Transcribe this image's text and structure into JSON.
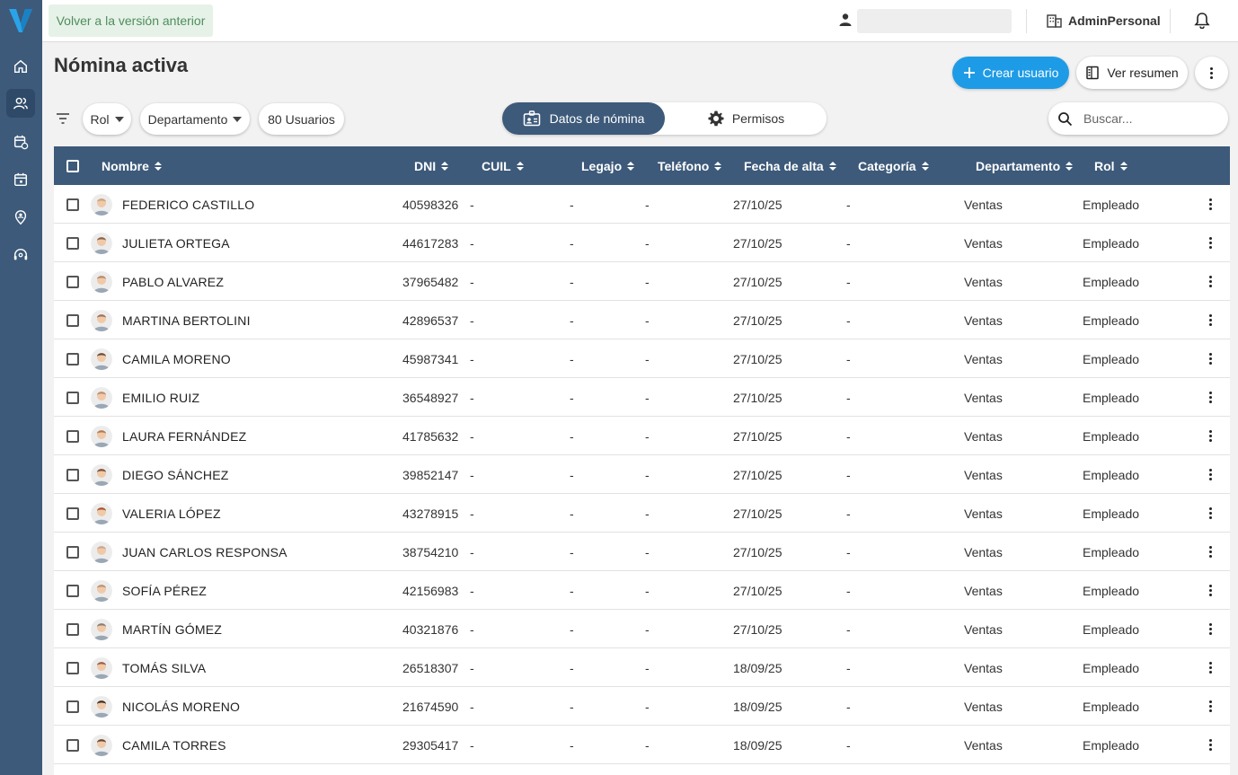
{
  "topbar": {
    "back_label": "Volver a la versión anterior",
    "org_name": "AdminPersonal"
  },
  "page": {
    "title": "Nómina activa",
    "create_label": "Crear usuario",
    "summary_label": "Ver resumen"
  },
  "filters": {
    "rol_label": "Rol",
    "departamento_label": "Departamento",
    "count_label": "80 Usuarios",
    "tab_nomina": "Datos de nómina",
    "tab_permisos": "Permisos",
    "search_placeholder": "Buscar..."
  },
  "colors": {
    "sidebar": "#3d5a7a",
    "accent": "#1e9be6",
    "back_bg": "#e6f2e8",
    "back_text": "#4f8d5c"
  },
  "table": {
    "columns": {
      "nombre": "Nombre",
      "dni": "DNI",
      "cuil": "CUIL",
      "legajo": "Legajo",
      "telefono": "Teléfono",
      "fecha": "Fecha de alta",
      "categoria": "Categoría",
      "departamento": "Departamento",
      "rol": "Rol"
    },
    "rows": [
      {
        "nombre": "FEDERICO CASTILLO",
        "dni": "40598326",
        "cuil": "-",
        "legajo": "-",
        "telefono": "-",
        "fecha": "27/10/25",
        "categoria": "-",
        "departamento": "Ventas",
        "rol": "Empleado",
        "avatar_color": "#c9a27e"
      },
      {
        "nombre": "JULIETA ORTEGA",
        "dni": "44617283",
        "cuil": "-",
        "legajo": "-",
        "telefono": "-",
        "fecha": "27/10/25",
        "categoria": "-",
        "departamento": "Ventas",
        "rol": "Empleado",
        "avatar_color": "#8a6347"
      },
      {
        "nombre": "PABLO ALVAREZ",
        "dni": "37965482",
        "cuil": "-",
        "legajo": "-",
        "telefono": "-",
        "fecha": "27/10/25",
        "categoria": "-",
        "departamento": "Ventas",
        "rol": "Empleado",
        "avatar_color": "#b58a6c"
      },
      {
        "nombre": "MARTINA BERTOLINI",
        "dni": "42896537",
        "cuil": "-",
        "legajo": "-",
        "telefono": "-",
        "fecha": "27/10/25",
        "categoria": "-",
        "departamento": "Ventas",
        "rol": "Empleado",
        "avatar_color": "#a0705a"
      },
      {
        "nombre": "CAMILA MORENO",
        "dni": "45987341",
        "cuil": "-",
        "legajo": "-",
        "telefono": "-",
        "fecha": "27/10/25",
        "categoria": "-",
        "departamento": "Ventas",
        "rol": "Empleado",
        "avatar_color": "#6b4a36"
      },
      {
        "nombre": "EMILIO RUIZ",
        "dni": "36548927",
        "cuil": "-",
        "legajo": "-",
        "telefono": "-",
        "fecha": "27/10/25",
        "categoria": "-",
        "departamento": "Ventas",
        "rol": "Empleado",
        "avatar_color": "#c08d6b"
      },
      {
        "nombre": "LAURA FERNÁNDEZ",
        "dni": "41785632",
        "cuil": "-",
        "legajo": "-",
        "telefono": "-",
        "fecha": "27/10/25",
        "categoria": "-",
        "departamento": "Ventas",
        "rol": "Empleado",
        "avatar_color": "#b07a55"
      },
      {
        "nombre": "DIEGO SÁNCHEZ",
        "dni": "39852147",
        "cuil": "-",
        "legajo": "-",
        "telefono": "-",
        "fecha": "27/10/25",
        "categoria": "-",
        "departamento": "Ventas",
        "rol": "Empleado",
        "avatar_color": "#7d4e38"
      },
      {
        "nombre": "VALERIA LÓPEZ",
        "dni": "43278915",
        "cuil": "-",
        "legajo": "-",
        "telefono": "-",
        "fecha": "27/10/25",
        "categoria": "-",
        "departamento": "Ventas",
        "rol": "Empleado",
        "avatar_color": "#a8542f"
      },
      {
        "nombre": "JUAN CARLOS RESPONSA",
        "dni": "38754210",
        "cuil": "-",
        "legajo": "-",
        "telefono": "-",
        "fecha": "27/10/25",
        "categoria": "-",
        "departamento": "Ventas",
        "rol": "Empleado",
        "avatar_color": "#c9a88e"
      },
      {
        "nombre": "SOFÍA PÉREZ",
        "dni": "42156983",
        "cuil": "-",
        "legajo": "-",
        "telefono": "-",
        "fecha": "27/10/25",
        "categoria": "-",
        "departamento": "Ventas",
        "rol": "Empleado",
        "avatar_color": "#b99272"
      },
      {
        "nombre": "MARTÍN GÓMEZ",
        "dni": "40321876",
        "cuil": "-",
        "legajo": "-",
        "telefono": "-",
        "fecha": "27/10/25",
        "categoria": "-",
        "departamento": "Ventas",
        "rol": "Empleado",
        "avatar_color": "#8c7d70"
      },
      {
        "nombre": "TOMÁS SILVA",
        "dni": "26518307",
        "cuil": "-",
        "legajo": "-",
        "telefono": "-",
        "fecha": "18/09/25",
        "categoria": "-",
        "departamento": "Ventas",
        "rol": "Empleado",
        "avatar_color": "#9a5f48"
      },
      {
        "nombre": "NICOLÁS MORENO",
        "dni": "21674590",
        "cuil": "-",
        "legajo": "-",
        "telefono": "-",
        "fecha": "18/09/25",
        "categoria": "-",
        "departamento": "Ventas",
        "rol": "Empleado",
        "avatar_color": "#3e2a20"
      },
      {
        "nombre": "CAMILA TORRES",
        "dni": "29305417",
        "cuil": "-",
        "legajo": "-",
        "telefono": "-",
        "fecha": "18/09/25",
        "categoria": "-",
        "departamento": "Ventas",
        "rol": "Empleado",
        "avatar_color": "#6a4630"
      }
    ]
  }
}
